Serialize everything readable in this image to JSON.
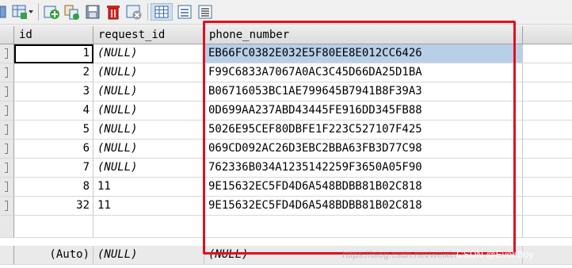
{
  "toolbar": {
    "icons": [
      "grid-view-dropdown-icon",
      "add-row-icon",
      "duplicate-row-icon",
      "save-icon",
      "delete-icon",
      "cancel-icon",
      "grid-mode-icon",
      "form-mode-icon",
      "text-mode-icon"
    ]
  },
  "columns": {
    "id": "id",
    "request_id": "request_id",
    "phone_number": "phone_number"
  },
  "rows": [
    {
      "id": "1",
      "request_id": "(NULL)",
      "phone_number": "EB66FC0382E032E5F80EE8E012CC6426"
    },
    {
      "id": "2",
      "request_id": "(NULL)",
      "phone_number": "F99C6833A7067A0AC3C45D66DA25D1BA"
    },
    {
      "id": "3",
      "request_id": "(NULL)",
      "phone_number": "B06716053BC1AE799645B7941B8F39A3"
    },
    {
      "id": "4",
      "request_id": "(NULL)",
      "phone_number": "0D699AA237ABD43445FE916DD345FB88"
    },
    {
      "id": "5",
      "request_id": "(NULL)",
      "phone_number": "5026E95CEF80DBFE1F223C527107F425"
    },
    {
      "id": "6",
      "request_id": "(NULL)",
      "phone_number": "069CD092AC26D3EBC2BBA63FB3D77C98"
    },
    {
      "id": "7",
      "request_id": "(NULL)",
      "phone_number": "762336B034A1235142259F3650A05F90"
    },
    {
      "id": "8",
      "request_id": "11",
      "phone_number": "9E15632EC5FD4D6A548BDBB81B02C818"
    },
    {
      "id": "32",
      "request_id": "11",
      "phone_number": "9E15632EC5FD4D6A548BDBB81B02C818"
    }
  ],
  "new_row": {
    "id": "(Auto)",
    "request_id": "(NULL)",
    "phone_number": "(NULL)"
  },
  "watermark": {
    "text": "https://blog.csdn.net/weixin",
    "author": "CSDN @EvenBoy"
  },
  "colors": {
    "highlight_box": "#e0101e",
    "selected_row": "#b8cfe8"
  }
}
